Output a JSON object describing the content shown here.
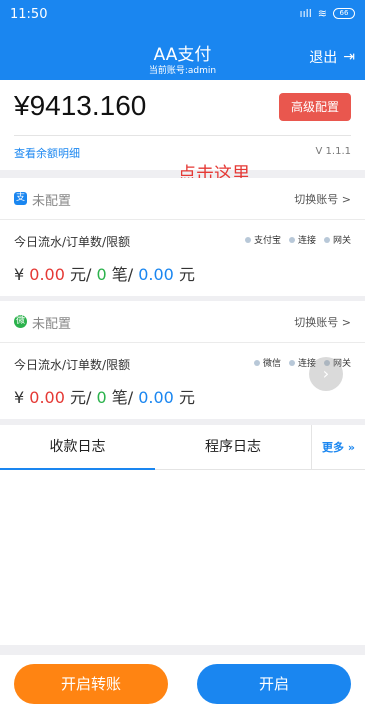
{
  "status_bar": {
    "time": "11:50",
    "signal": "ııll",
    "wifi": "≋",
    "battery": "66"
  },
  "header": {
    "title": "AA支付",
    "subtitle": "当前账号:admin",
    "logout_label": "退出",
    "logout_icon": "⇥"
  },
  "balance_card": {
    "balance": "¥9413.160",
    "advanced_button": "高级配置",
    "detail_link": "查看余额明细",
    "version": "V 1.1.1"
  },
  "annotation": {
    "text": "点击这里",
    "color": "#e53935"
  },
  "accounts": [
    {
      "icon": "alipay-icon",
      "icon_glyph": "支",
      "icon_color": "#1a86f0",
      "status": "未配置",
      "switch_label": "切换账号 >",
      "stats_label": "今日流水/订单数/限额",
      "chips": [
        "支付宝",
        "连接",
        "网关"
      ],
      "amount": "0.00",
      "amount_unit": " 元/ ",
      "orders": "0",
      "orders_unit": " 笔/ ",
      "limit": "0.00",
      "limit_unit": " 元",
      "currency": "¥ "
    },
    {
      "icon": "wechat-icon",
      "icon_glyph": "微",
      "icon_color": "#2bb24c",
      "status": "未配置",
      "switch_label": "切换账号 >",
      "stats_label": "今日流水/订单数/限额",
      "chips": [
        "微信",
        "连接",
        "网关"
      ],
      "amount": "0.00",
      "amount_unit": " 元/ ",
      "orders": "0",
      "orders_unit": " 笔/ ",
      "limit": "0.00",
      "limit_unit": " 元",
      "currency": "¥ "
    }
  ],
  "tabs": [
    {
      "label": "收款日志",
      "active": true
    },
    {
      "label": "程序日志",
      "active": false
    }
  ],
  "tab_more": "更多 »",
  "footer": {
    "transfer_button": "开启转账",
    "start_button": "开启"
  },
  "colors": {
    "primary": "#1a86f0",
    "danger": "#e9574e",
    "orange": "#ff8412",
    "success": "#2bb24c"
  }
}
